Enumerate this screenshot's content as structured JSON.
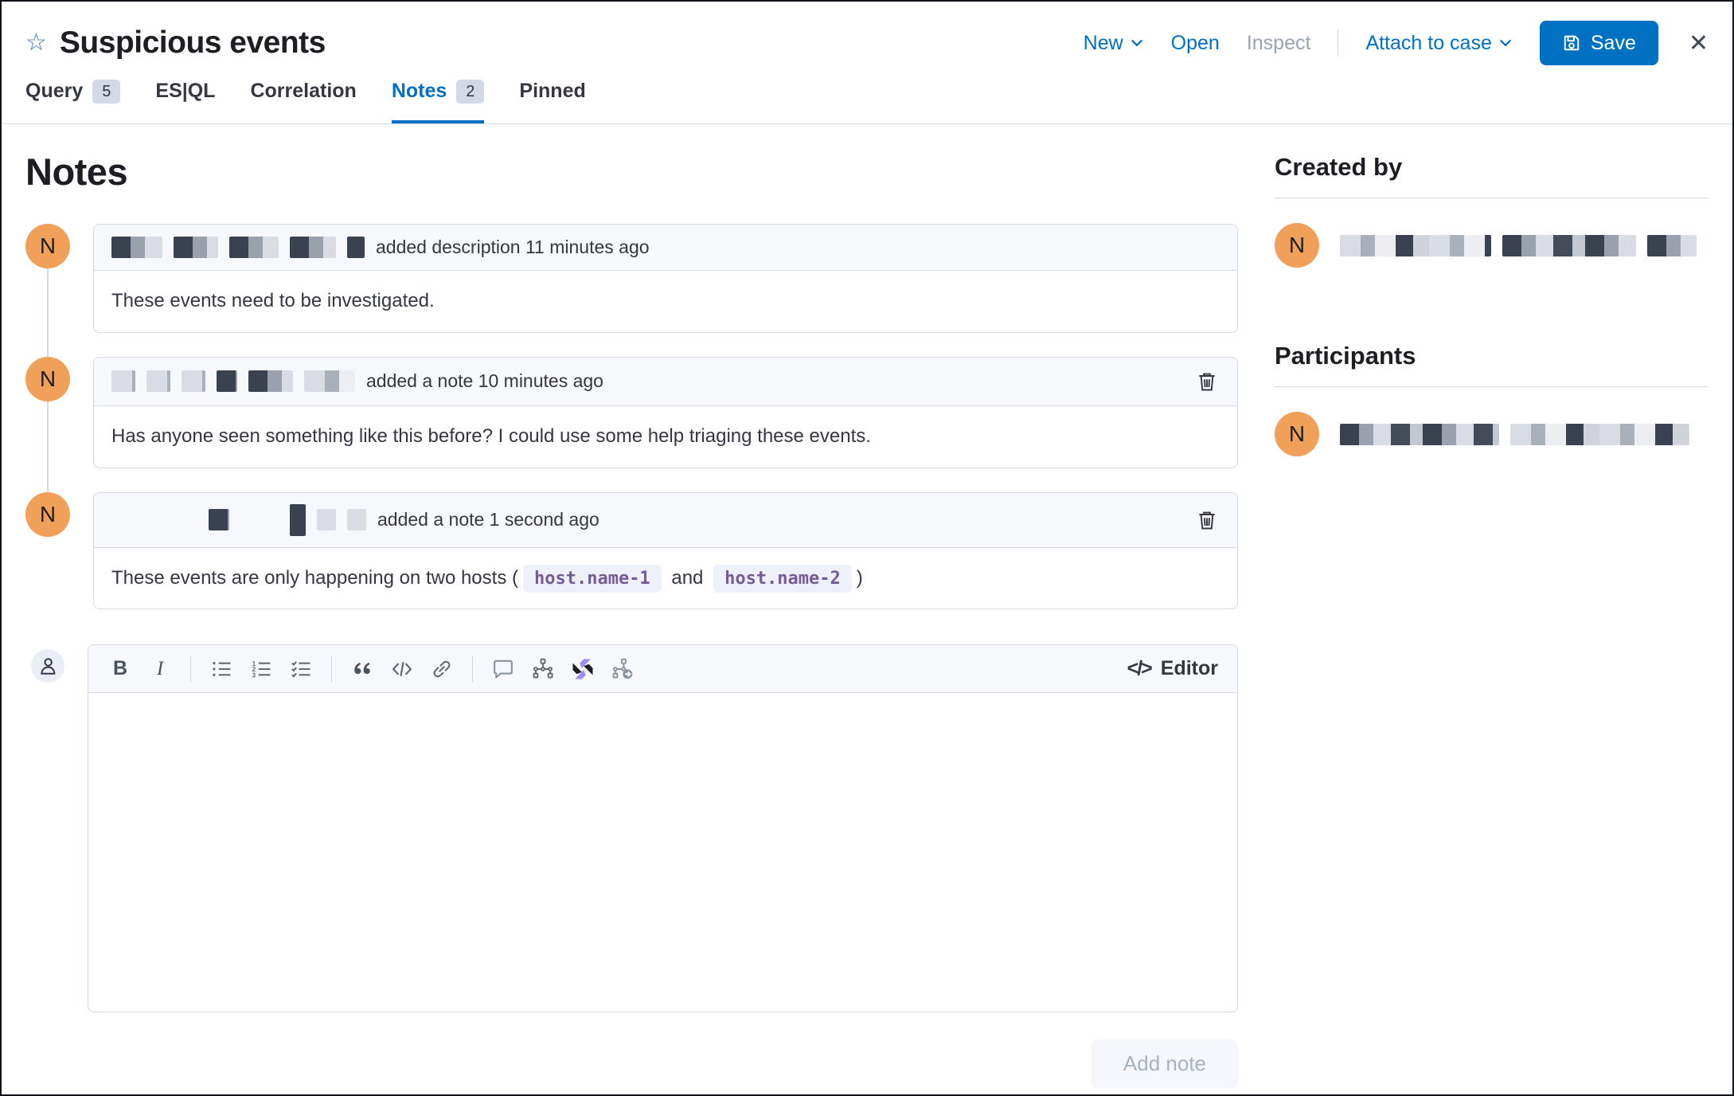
{
  "header": {
    "title": "Suspicious events",
    "actions": {
      "new": "New",
      "open": "Open",
      "inspect": "Inspect",
      "attach": "Attach to case",
      "save": "Save"
    }
  },
  "icons": {
    "star": "☆",
    "close": "✕",
    "code": "</>"
  },
  "tabs": [
    {
      "label": "Query",
      "badge": "5"
    },
    {
      "label": "ES|QL"
    },
    {
      "label": "Correlation"
    },
    {
      "label": "Notes",
      "badge": "2"
    },
    {
      "label": "Pinned"
    }
  ],
  "page": {
    "heading": "Notes"
  },
  "notes": [
    {
      "avatar_initial": "N",
      "event": "added description 11 minutes ago",
      "body": "These events need to be investigated."
    },
    {
      "avatar_initial": "N",
      "event": "added a note 10 minutes ago",
      "body": "Has anyone seen something like this before? I could use some help triaging these events."
    },
    {
      "avatar_initial": "N",
      "event": "added a note 1 second ago",
      "body_prefix": "These events are only happening on two hosts (",
      "code_1": "host.name-1",
      "body_and": "and",
      "code_2": "host.name-2",
      "body_suffix": ")"
    }
  ],
  "editor": {
    "toolbar": {
      "bold": "B",
      "italic": "I",
      "code": "</>"
    },
    "label": "Editor",
    "add_note": "Add note"
  },
  "sidebar": {
    "created_by_heading": "Created by",
    "participants_heading": "Participants",
    "avatar_initial": "N"
  },
  "colors": {
    "primary": "#0071C2",
    "avatar_orange": "#F1A05A",
    "code_purple": "#765B96",
    "panel_header": "#F7F8FC",
    "border": "#D3DAE6"
  }
}
